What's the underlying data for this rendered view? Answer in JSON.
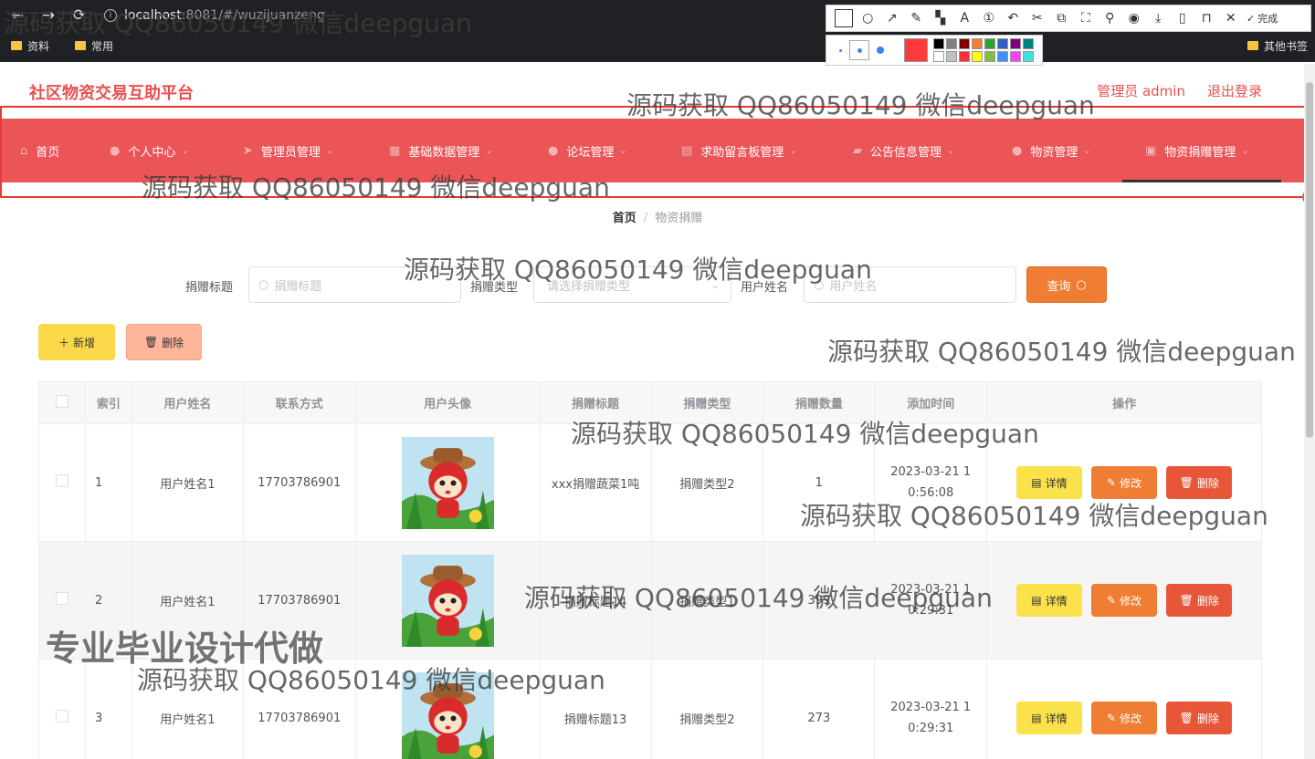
{
  "browser": {
    "url_host": "localhost",
    "url_rest": ":8081/#/wuzijuanzeng",
    "bookmarks": [
      "资料",
      "常用"
    ],
    "bookmarks_right": "其他书签"
  },
  "snip": {
    "done_label": "完成",
    "swatch_colors": [
      "#000000",
      "#808080",
      "#800000",
      "#f08030",
      "#30a030",
      "#3060c0",
      "#800080",
      "#008080",
      "#ffffff",
      "#c0c0c0",
      "#ff3030",
      "#ffff00",
      "#80c040",
      "#4090ff",
      "#ff40ff",
      "#40e0e0"
    ],
    "current_color": "#ff3a3a"
  },
  "header": {
    "title": "社区物资交易互助平台",
    "user": "管理员 admin",
    "logout": "退出登录"
  },
  "menu": {
    "items": [
      {
        "label": "首页",
        "icon": "home-icon",
        "has_caret": false
      },
      {
        "label": "个人中心",
        "icon": "user-icon",
        "has_caret": true
      },
      {
        "label": "管理员管理",
        "icon": "send-icon",
        "has_caret": true
      },
      {
        "label": "基础数据管理",
        "icon": "grid-icon",
        "has_caret": true
      },
      {
        "label": "论坛管理",
        "icon": "user-icon",
        "has_caret": true
      },
      {
        "label": "求助留言板管理",
        "icon": "calendar-icon",
        "has_caret": true
      },
      {
        "label": "公告信息管理",
        "icon": "folder-icon",
        "has_caret": true
      },
      {
        "label": "物资管理",
        "icon": "location-icon",
        "has_caret": true
      },
      {
        "label": "物资捐赠管理",
        "icon": "image-icon",
        "has_caret": true
      }
    ],
    "active_index": 8,
    "bg_color": "#ec5558"
  },
  "breadcrumb": {
    "home": "首页",
    "current": "物资捐赠"
  },
  "search": {
    "title_label": "捐赠标题",
    "title_placeholder": "捐赠标题",
    "type_label": "捐赠类型",
    "type_placeholder": "请选择捐赠类型",
    "user_label": "用户姓名",
    "user_placeholder": "用户姓名",
    "query_label": "查询"
  },
  "actions": {
    "add_label": "新增",
    "delete_label": "删除"
  },
  "table": {
    "columns": [
      "索引",
      "用户姓名",
      "联系方式",
      "用户头像",
      "捐赠标题",
      "捐赠类型",
      "捐赠数量",
      "添加时间",
      "操作"
    ],
    "rows": [
      {
        "index": "1",
        "name": "用户姓名1",
        "phone": "17703786901",
        "title": "xxx捐赠蔬菜1吨",
        "type": "捐赠类型2",
        "qty": "1",
        "time1": "2023-03-21 1",
        "time2": "0:56:08"
      },
      {
        "index": "2",
        "name": "用户姓名1",
        "phone": "17703786901",
        "title": "捐赠标题14",
        "type": "捐赠类型1",
        "qty": "399",
        "time1": "2023-03-21 1",
        "time2": "0:29:31"
      },
      {
        "index": "3",
        "name": "用户姓名1",
        "phone": "17703786901",
        "title": "捐赠标题13",
        "type": "捐赠类型2",
        "qty": "273",
        "time1": "2023-03-21 1",
        "time2": "0:29:31"
      }
    ],
    "op_detail": "详情",
    "op_edit": "修改",
    "op_delete": "删除"
  },
  "watermark": {
    "text": "源码获取 QQ86050149 微信deepguan",
    "promo": "专业毕业设计代做"
  }
}
